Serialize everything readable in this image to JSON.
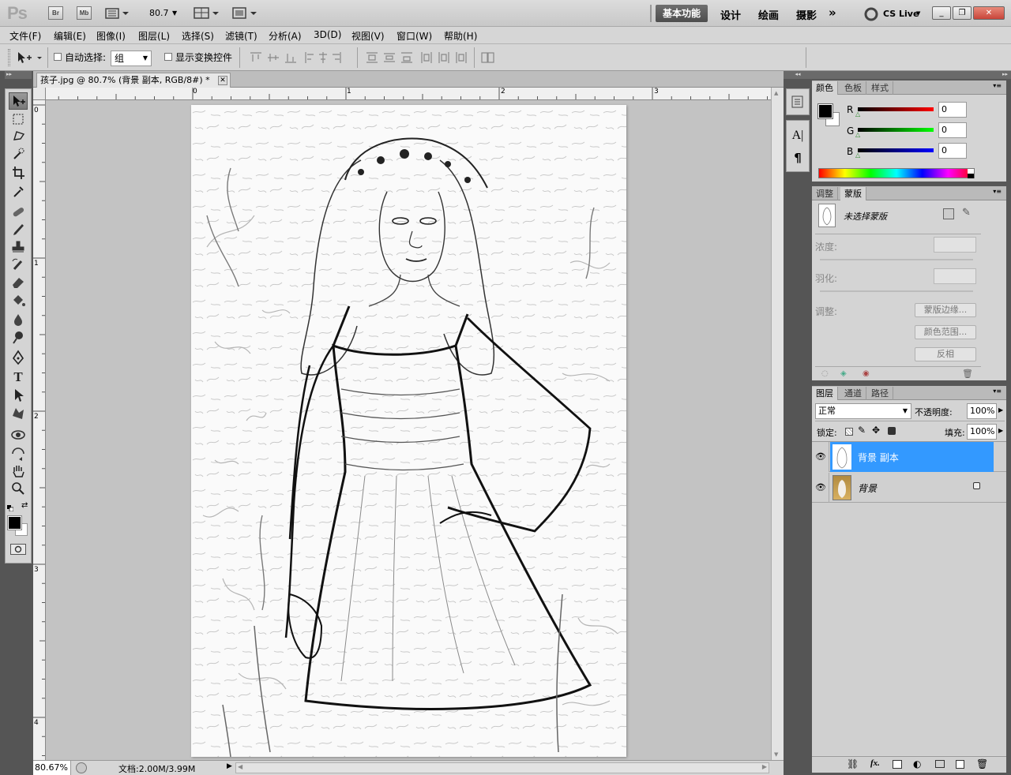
{
  "app": {
    "logo": "Ps",
    "bridge_label": "Br",
    "minibridge_label": "Mb",
    "zoom_value": "80.7",
    "workspaces": [
      "基本功能",
      "设计",
      "绘画",
      "摄影"
    ],
    "cs_live": "CS Live"
  },
  "menu": [
    "文件(F)",
    "编辑(E)",
    "图像(I)",
    "图层(L)",
    "选择(S)",
    "滤镜(T)",
    "分析(A)",
    "3D(D)",
    "视图(V)",
    "窗口(W)",
    "帮助(H)"
  ],
  "options": {
    "auto_select_label": "自动选择:",
    "auto_select_value": "组",
    "show_transform_label": "显示变换控件"
  },
  "document": {
    "tab_title": "孩子.jpg @ 80.7% (背景 副本, RGB/8#) *",
    "ruler_top_labels": [
      "0",
      "1",
      "2",
      "3"
    ],
    "ruler_left_labels": [
      "0",
      "1",
      "2",
      "3",
      "4"
    ],
    "zoom_status": "80.67%",
    "doc_size": "文档:2.00M/3.99M"
  },
  "color_panel": {
    "tabs": [
      "颜色",
      "色板",
      "样式"
    ],
    "channels": [
      {
        "label": "R",
        "value": "0",
        "color": "#cc0000"
      },
      {
        "label": "G",
        "value": "0",
        "color": "#00aa00"
      },
      {
        "label": "B",
        "value": "0",
        "color": "#0000cc"
      }
    ]
  },
  "masks_panel": {
    "tabs": [
      "调整",
      "蒙版"
    ],
    "no_mask_label": "未选择蒙版",
    "density_label": "浓度:",
    "feather_label": "羽化:",
    "refine_label": "调整:",
    "mask_edge_button": "蒙版边缘...",
    "color_range_button": "颜色范围...",
    "invert_button": "反相"
  },
  "layers_panel": {
    "tabs": [
      "图层",
      "通道",
      "路径"
    ],
    "blend_mode": "正常",
    "opacity_label": "不透明度:",
    "opacity_value": "100%",
    "lock_label": "锁定:",
    "fill_label": "填充:",
    "fill_value": "100%",
    "layers": [
      {
        "name": "背景 副本",
        "selected": true
      },
      {
        "name": "背景",
        "selected": false
      }
    ]
  },
  "colors": {
    "selection": "#3399ff",
    "panel_bg": "#d4d4d4"
  }
}
